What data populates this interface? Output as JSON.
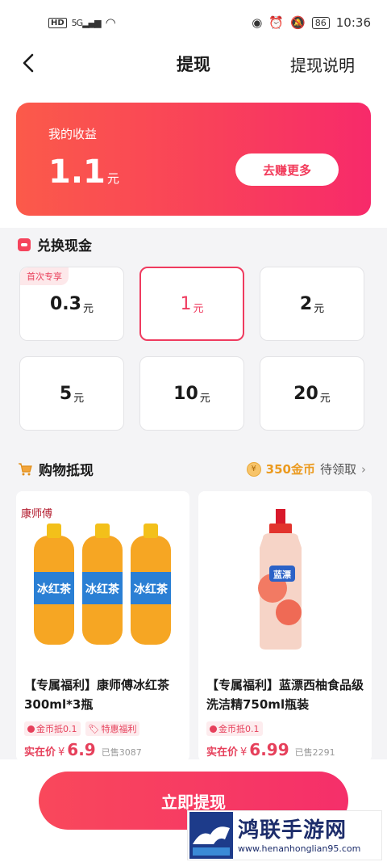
{
  "status_bar": {
    "left_badge": "HD",
    "signal": "5G",
    "battery": "86",
    "time": "10:36"
  },
  "nav": {
    "title": "提现",
    "help": "提现说明"
  },
  "earnings": {
    "label": "我的收益",
    "amount": "1.1",
    "unit": "元",
    "more_button": "去赚更多"
  },
  "exchange": {
    "title": "兑换现金",
    "options": [
      {
        "value": "0.3",
        "unit": "元",
        "badge": "首次专享"
      },
      {
        "value": "1",
        "unit": "元",
        "selected": true
      },
      {
        "value": "2",
        "unit": "元"
      },
      {
        "value": "5",
        "unit": "元"
      },
      {
        "value": "10",
        "unit": "元"
      },
      {
        "value": "20",
        "unit": "元"
      }
    ]
  },
  "shopping": {
    "title": "购物抵现",
    "coins_amount": "350金币",
    "coins_status": "待领取"
  },
  "products": [
    {
      "title": "【专属福利】康师傅冰红茶300ml*3瓶",
      "tags": [
        "金币抵0.1",
        "特惠福利"
      ],
      "price_label": "实在价",
      "currency": "¥",
      "price": "6.9",
      "sold": "已售3087",
      "brand_text": "康师傅",
      "product_text": "冰红茶"
    },
    {
      "title": "【专属福利】蓝漂西柚食品级洗洁精750ml瓶装",
      "tags": [
        "金币抵0.1"
      ],
      "price_label": "实在价",
      "currency": "¥",
      "price": "6.99",
      "sold": "已售2291",
      "product_text": "蓝漂"
    }
  ],
  "withdraw_button": "立即提现",
  "watermark": {
    "title": "鸿联手游网",
    "url": "www.henanhonglian95.com"
  },
  "colors": {
    "accent": "#f23a5a",
    "gold": "#eb9a1f"
  }
}
